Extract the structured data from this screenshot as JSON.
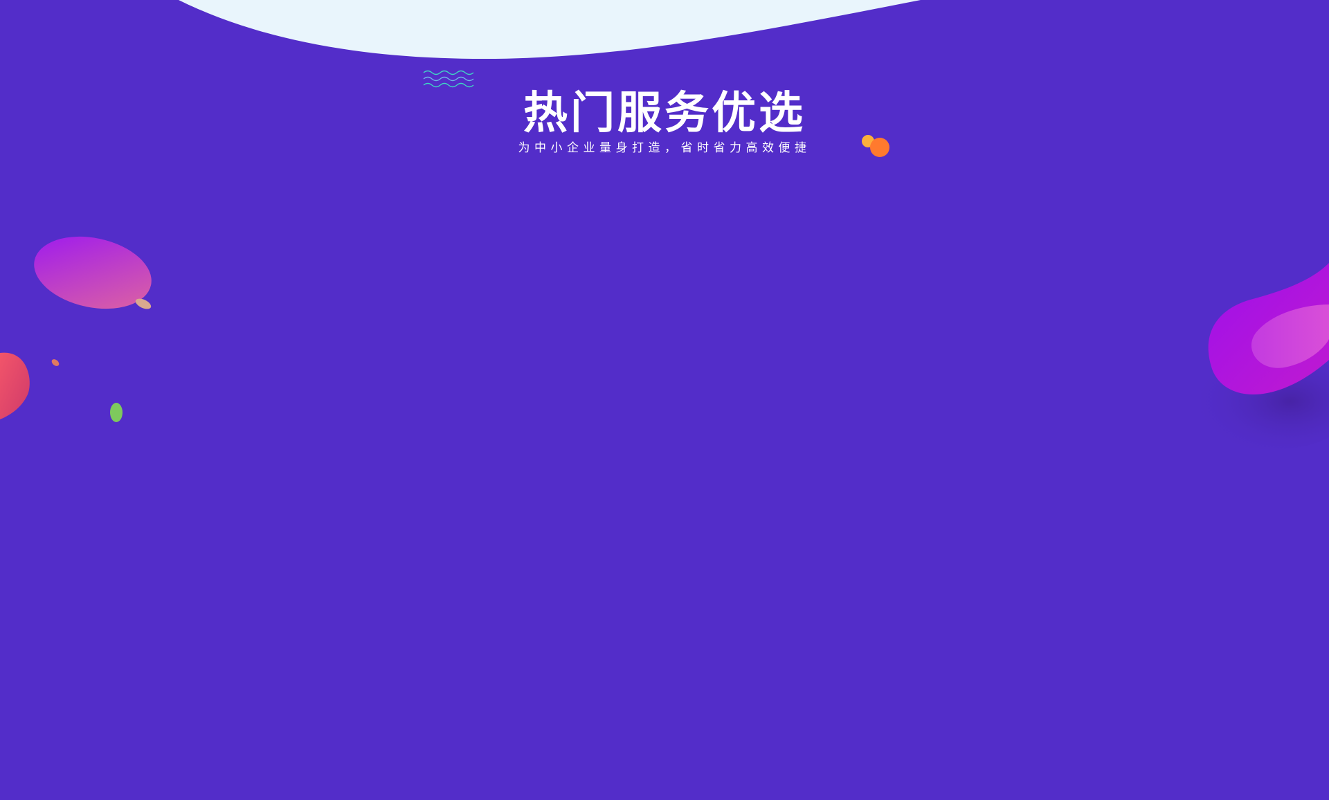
{
  "section": {
    "title": "热门服务优选",
    "subtitle": "为中小企业量身打造，省时省力高效便捷"
  },
  "colors": {
    "background": "#532dc9",
    "top_wave": "#e9f5fc",
    "title_text": "#ffffff",
    "dot_yellow": "#fbb03b",
    "dot_orange": "#ff7a2e",
    "wave_lines": "#3fd6c4"
  },
  "decorations": {
    "icons": [
      "top-wave-shape",
      "wave-lines-icon",
      "orange-dots-icon",
      "left-blob-shape",
      "right-blob-shape"
    ]
  }
}
